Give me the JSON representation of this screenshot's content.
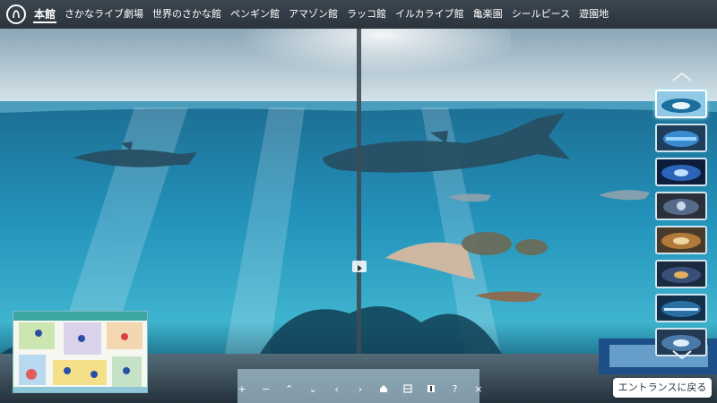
{
  "nav": {
    "logo_icon": "aquarium-logo-icon",
    "tabs": [
      {
        "label": "本館",
        "active": true
      },
      {
        "label": "さかなライブ劇場",
        "active": false
      },
      {
        "label": "世界のさかな館",
        "active": false
      },
      {
        "label": "ペンギン館",
        "active": false
      },
      {
        "label": "アマゾン館",
        "active": false
      },
      {
        "label": "ラッコ館",
        "active": false
      },
      {
        "label": "イルカライブ館",
        "active": false
      },
      {
        "label": "亀楽園",
        "active": false
      },
      {
        "label": "シールピース",
        "active": false
      },
      {
        "label": "遊園地",
        "active": false
      }
    ]
  },
  "thumbnails": {
    "up_icon": "chevron-up-icon",
    "down_icon": "chevron-down-icon",
    "active_index": 0,
    "count": 8
  },
  "toolbar": {
    "items": [
      {
        "icon": "zoom-in-icon",
        "glyph": "+"
      },
      {
        "icon": "zoom-out-icon",
        "glyph": "−"
      },
      {
        "icon": "up-arrow-icon",
        "glyph": "⌃"
      },
      {
        "icon": "down-arrow-icon",
        "glyph": "⌄"
      },
      {
        "icon": "left-arrow-icon",
        "glyph": "‹"
      },
      {
        "icon": "right-arrow-icon",
        "glyph": "›"
      },
      {
        "icon": "home-icon",
        "glyph": ""
      },
      {
        "icon": "map-icon",
        "glyph": ""
      },
      {
        "icon": "info-icon",
        "glyph": ""
      },
      {
        "icon": "help-icon",
        "glyph": "?"
      },
      {
        "icon": "close-icon",
        "glyph": "×"
      }
    ]
  },
  "entrance_button": {
    "label": "エントランスに戻る"
  },
  "minimap": {
    "icon": "floor-map-icon"
  },
  "colors": {
    "nav_bg": "#2b343c",
    "water": "#1a7fa8",
    "accent": "#ffffff"
  }
}
